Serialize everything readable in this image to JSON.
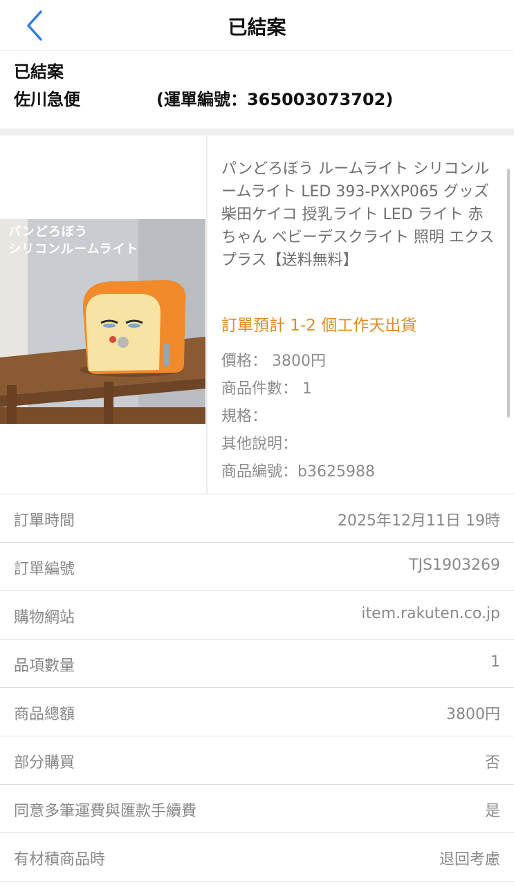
{
  "nav": {
    "title": "已結案"
  },
  "status": {
    "state": "已結案",
    "carrier": "佐川急便",
    "tracking": "(運單編號：365003073702)"
  },
  "product": {
    "image_caption_line1": "パンどろぼう",
    "image_caption_line2": "シリコンルームライト",
    "name": "パンどろぼう ルームライト シリコンルームライト LED 393-PXXP065 グッズ 柴田ケイコ 授乳ライト LED ライト 赤ちゃん ベビーデスクライト 照明 エクスプラス【送料無料】",
    "estimate": "訂單預計 1-2 個工作天出貨",
    "price": "價格：  3800円",
    "quantity": "商品件數：  1",
    "spec": "規格：",
    "note": "其他說明：",
    "code": "商品編號：b3625988"
  },
  "details": [
    {
      "label": "訂單時間",
      "value": "2025年12月11日 19時"
    },
    {
      "label": "訂單編號",
      "value": "TJS1903269"
    },
    {
      "label": "購物網站",
      "value": "item.rakuten.co.jp"
    },
    {
      "label": "品項數量",
      "value": "1"
    },
    {
      "label": "商品總額",
      "value": "3800円"
    },
    {
      "label": "部分購買",
      "value": "否"
    },
    {
      "label": "同意多筆運費與匯款手續費",
      "value": "是"
    },
    {
      "label": "有材積商品時",
      "value": "退回考慮"
    }
  ],
  "colors": {
    "accent_blue": "#2f7de1",
    "estimate_orange": "#e08a1e"
  },
  "icons": {
    "back": "chevron-left-icon"
  }
}
